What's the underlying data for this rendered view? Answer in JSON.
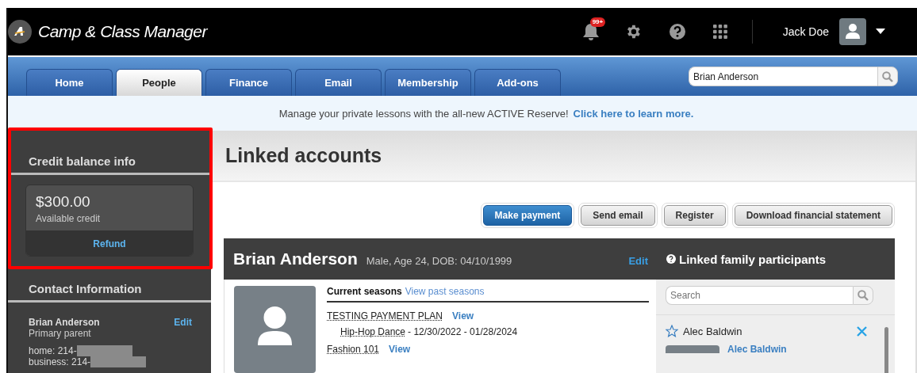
{
  "header": {
    "app_title": "Camp & Class Manager",
    "notification_count": "99+",
    "user_name": "Jack Doe"
  },
  "tabs": [
    {
      "label": "Home",
      "selected": false
    },
    {
      "label": "People",
      "selected": true
    },
    {
      "label": "Finance",
      "selected": false
    },
    {
      "label": "Email",
      "selected": false
    },
    {
      "label": "Membership",
      "selected": false
    },
    {
      "label": "Add-ons",
      "selected": false
    }
  ],
  "search": {
    "value": "Brian Anderson"
  },
  "banner": {
    "text": "Manage your private lessons with the all-new ACTIVE Reserve!",
    "link": "Click here to learn more."
  },
  "sidebar": {
    "credit": {
      "title": "Credit balance info",
      "amount": "$300.00",
      "caption": "Available credit",
      "action": "Refund",
      "highlighted": true
    },
    "contact": {
      "title": "Contact Information",
      "name": "Brian Anderson",
      "edit": "Edit",
      "role": "Primary parent",
      "phones": [
        "home: 214-",
        "business: 214-"
      ]
    }
  },
  "page_title": "Linked accounts",
  "actions": [
    {
      "label": "Make payment",
      "kind": "primary"
    },
    {
      "label": "Send email",
      "kind": "secondary"
    },
    {
      "label": "Register",
      "kind": "secondary"
    },
    {
      "label": "Download financial statement",
      "kind": "secondary"
    }
  ],
  "person": {
    "name": "Brian Anderson",
    "details": "Male, Age 24, DOB: 04/10/1999",
    "edit": "Edit",
    "seasons_heading": "Current seasons",
    "seasons_link": "View past seasons",
    "programs": [
      {
        "name": "TESTING PAYMENT PLAN",
        "view": "View",
        "sessions": [
          {
            "name": "Hip-Hop Dance",
            "dates": "- 12/30/2022 - 01/28/2024"
          }
        ]
      },
      {
        "name": "Fashion 101",
        "view": "View"
      }
    ]
  },
  "family": {
    "title": "Linked family participants",
    "search_placeholder": "Search",
    "members": [
      {
        "name": "Alec Baldwin",
        "link": "Alec Baldwin"
      }
    ]
  }
}
